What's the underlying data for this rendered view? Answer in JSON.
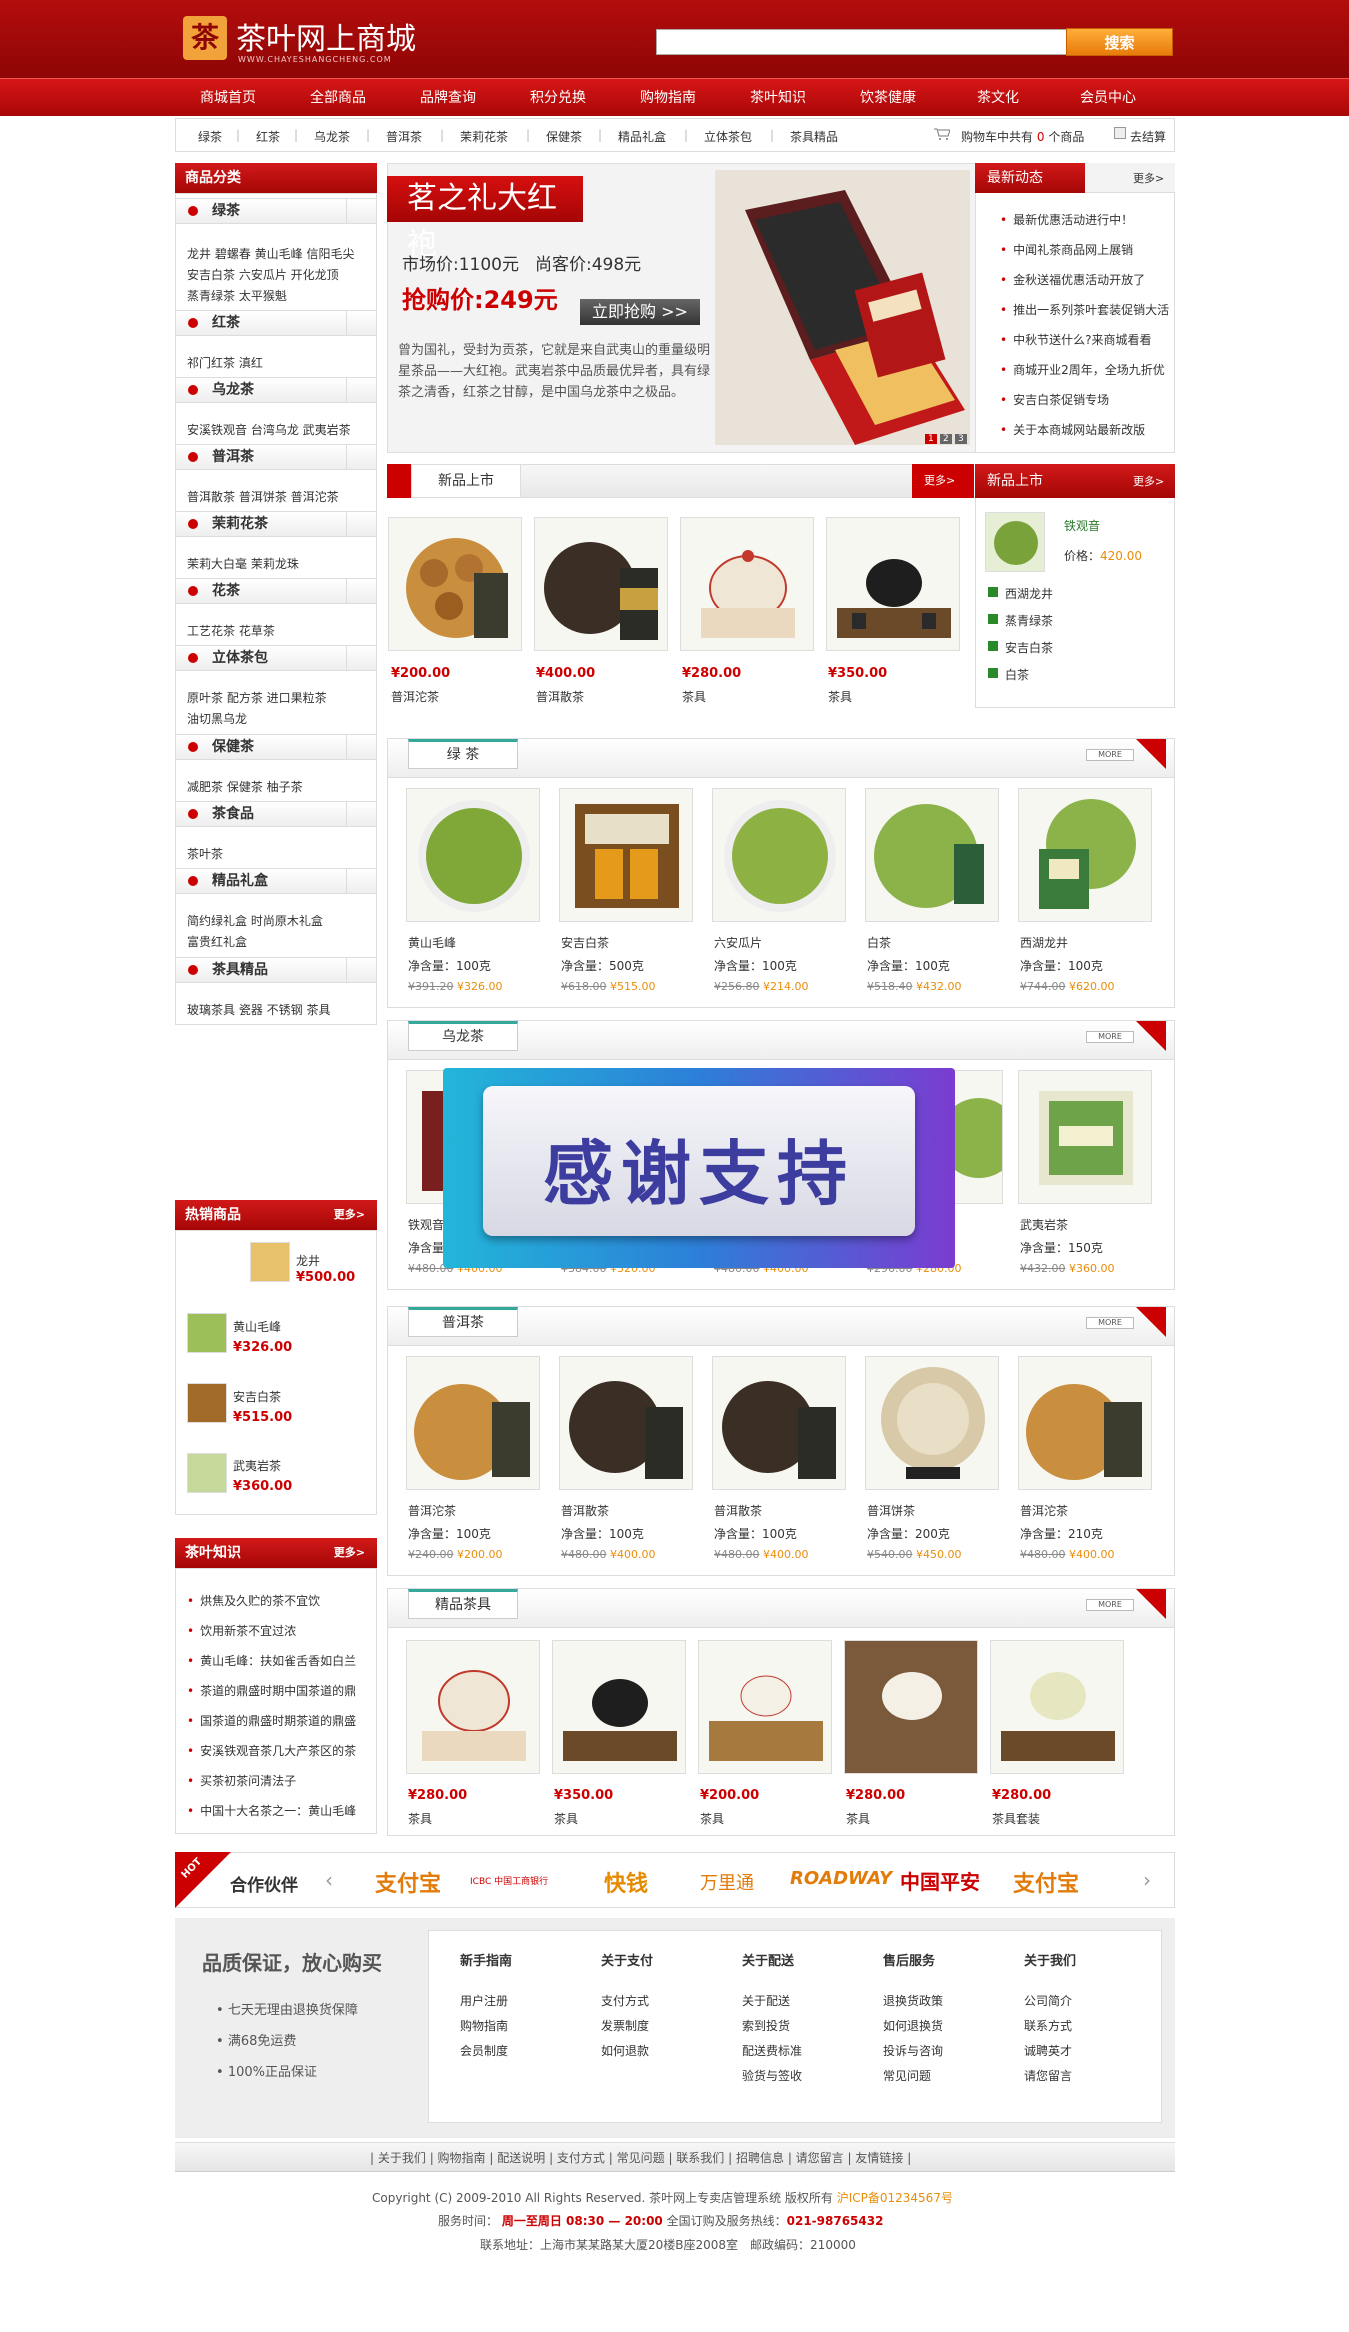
{
  "header": {
    "logo_char": "茶",
    "title": "茶叶网上商城",
    "domain": "WWW.CHAYESHANGCHENG.COM",
    "search_placeholder": "",
    "search_button": "搜索"
  },
  "nav": [
    "商城首页",
    "全部商品",
    "品牌查询",
    "积分兑换",
    "购物指南",
    "茶叶知识",
    "饮茶健康",
    "茶文化",
    "会员中心"
  ],
  "subnav": [
    "绿茶",
    "红茶",
    "乌龙茶",
    "普洱茶",
    "茉莉花茶",
    "保健茶",
    "精品礼盒",
    "立体茶包",
    "茶具精品"
  ],
  "cart": {
    "prefix": "购物车中共有",
    "count": "0",
    "suffix": "个商品",
    "checkout": "去结算"
  },
  "left": {
    "category_title": "商品分类",
    "categories": [
      {
        "name": "绿茶",
        "items": [
          "龙井 碧螺春 黄山毛峰 信阳毛尖",
          "安吉白茶 六安瓜片 开化龙顶",
          "蒸青绿茶 太平猴魁"
        ]
      },
      {
        "name": "红茶",
        "items": [
          "祁门红茶 滇红"
        ]
      },
      {
        "name": "乌龙茶",
        "items": [
          "安溪铁观音 台湾乌龙 武夷岩茶"
        ]
      },
      {
        "name": "普洱茶",
        "items": [
          "普洱散茶 普洱饼茶 普洱沱茶"
        ]
      },
      {
        "name": "茉莉花茶",
        "items": [
          "茉莉大白毫 茉莉龙珠"
        ]
      },
      {
        "name": "花茶",
        "items": [
          "工艺花茶 花草茶"
        ]
      },
      {
        "name": "立体茶包",
        "items": [
          "原叶茶 配方茶 进口果粒茶",
          "油切黑乌龙"
        ]
      },
      {
        "name": "保健茶",
        "items": [
          "减肥茶 保健茶 柚子茶"
        ]
      },
      {
        "name": "茶食品",
        "items": [
          "茶叶茶"
        ]
      },
      {
        "name": "精品礼盒",
        "items": [
          "简约绿礼盒 时尚原木礼盒",
          "富贵红礼盒"
        ]
      },
      {
        "name": "茶具精品",
        "items": [
          "玻璃茶具 瓷器 不锈钢 茶具"
        ]
      }
    ],
    "hot_title": "热销商品",
    "hot_more": "更多>",
    "hot": [
      {
        "name": "龙井",
        "price": "¥500.00"
      },
      {
        "name": "黄山毛峰",
        "price": "¥326.00"
      },
      {
        "name": "安吉白茶",
        "price": "¥515.00"
      },
      {
        "name": "武夷岩茶",
        "price": "¥360.00"
      }
    ],
    "knowledge_title": "茶叶知识",
    "knowledge_more": "更多>",
    "knowledge": [
      "烘焦及久贮的茶不宜饮",
      "饮用新茶不宜过浓",
      "黄山毛峰：扶如雀舌香如白兰",
      "茶道的鼎盛时期中国茶道的鼎",
      "国茶道的鼎盛时期茶道的鼎盛",
      "安溪铁观音茶几大产茶区的茶",
      "买茶初茶问清法子",
      "中国十大名茶之一：黄山毛峰"
    ]
  },
  "banner": {
    "title": "茗之礼大红袍",
    "market": "市场价:1100元",
    "shop": "尚客价:498元",
    "sale": "抢购价:249元",
    "button": "立即抢购 >>",
    "desc": "曾为国礼，受封为贡茶，它就是来自武夷山的重量级明星茶品——大红袍。武夷岩茶中品质最优异者，具有绿茶之清香，红茶之甘醇，是中国乌龙茶中之极品。",
    "dots": [
      "1",
      "2",
      "3"
    ]
  },
  "latest": {
    "title": "最新动态",
    "more": "更多>",
    "items": [
      "最新优惠活动进行中！",
      "中闻礼茶商品网上展销",
      "金秋送福优惠活动开放了",
      "推出一系列茶叶套装促销大活",
      "中秋节送什么?来商城看看",
      "商城开业2周年，全场九折优",
      "安吉白茶促销专场",
      "关于本商城网站最新改版"
    ]
  },
  "newarrivals": {
    "title": "新品上市",
    "more": "更多>",
    "items": [
      {
        "price": "¥200.00",
        "name": "普洱沱茶"
      },
      {
        "price": "¥400.00",
        "name": "普洱散茶"
      },
      {
        "price": "¥280.00",
        "name": "茶具"
      },
      {
        "price": "¥350.00",
        "name": "茶具"
      }
    ]
  },
  "newright": {
    "title": "新品上市",
    "more": "更多>",
    "featured": {
      "name": "铁观音",
      "price_label": "价格：",
      "price": "420.00"
    },
    "list": [
      "西湖龙井",
      "蒸青绿茶",
      "安吉白茶",
      "白茶"
    ]
  },
  "sections": [
    {
      "title": "绿 茶",
      "more": "MORE",
      "items": [
        {
          "name": "黄山毛峰",
          "net": "净含量：100克",
          "old": "¥391.20",
          "price": "¥326.00"
        },
        {
          "name": "安吉白茶",
          "net": "净含量：500克",
          "old": "¥618.00",
          "price": "¥515.00"
        },
        {
          "name": "六安瓜片",
          "net": "净含量：100克",
          "old": "¥256.80",
          "price": "¥214.00"
        },
        {
          "name": "白茶",
          "net": "净含量：100克",
          "old": "¥518.40",
          "price": "¥432.00"
        },
        {
          "name": "西湖龙井",
          "net": "净含量：100克",
          "old": "¥744.00",
          "price": "¥620.00"
        }
      ]
    },
    {
      "title": "乌龙茶",
      "more": "MORE",
      "items": [
        {
          "name": "铁观音",
          "net": "净含量",
          "old": "¥480.00",
          "price": "¥400.00"
        },
        {
          "name": "",
          "net": "净含量",
          "old": "¥384.00",
          "price": "¥320.00"
        },
        {
          "name": "",
          "net": "净含量",
          "old": "¥480.00",
          "price": "¥400.00"
        },
        {
          "name": "",
          "net": "净含量",
          "old": "¥296.00",
          "price": "¥280.00"
        },
        {
          "name": "武夷岩茶",
          "net": "净含量：150克",
          "old": "¥432.00",
          "price": "¥360.00"
        }
      ]
    },
    {
      "title": "普洱茶",
      "more": "MORE",
      "items": [
        {
          "name": "普洱沱茶",
          "net": "净含量：100克",
          "old": "¥240.00",
          "price": "¥200.00"
        },
        {
          "name": "普洱散茶",
          "net": "净含量：100克",
          "old": "¥480.00",
          "price": "¥400.00"
        },
        {
          "name": "普洱散茶",
          "net": "净含量：100克",
          "old": "¥480.00",
          "price": "¥400.00"
        },
        {
          "name": "普洱饼茶",
          "net": "净含量：200克",
          "old": "¥540.00",
          "price": "¥450.00"
        },
        {
          "name": "普洱沱茶",
          "net": "净含量：210克",
          "old": "¥480.00",
          "price": "¥400.00"
        }
      ]
    },
    {
      "title": "精品茶具",
      "more": "MORE",
      "items": [
        {
          "price": "¥280.00",
          "name": "茶具"
        },
        {
          "price": "¥350.00",
          "name": "茶具"
        },
        {
          "price": "¥200.00",
          "name": "茶具"
        },
        {
          "price": "¥280.00",
          "name": "茶具"
        },
        {
          "price": "¥280.00",
          "name": "茶具套装"
        }
      ]
    }
  ],
  "overlay": {
    "text": "感谢支持"
  },
  "partners": {
    "hot": "HOT",
    "title": "合作伙伴",
    "logos": [
      "支付宝",
      "ICBC 中国工商银行",
      "快钱",
      "万里通",
      "ROADWAY",
      "中国平安",
      "支付宝"
    ]
  },
  "guarantee": {
    "title": "品质保证，放心购买",
    "items": [
      "七天无理由退换货保障",
      "满68免运费",
      "100%正品保证"
    ]
  },
  "footcols": [
    {
      "h": "新手指南",
      "items": [
        "用户注册",
        "购物指南",
        "会员制度"
      ]
    },
    {
      "h": "关于支付",
      "items": [
        "支付方式",
        "发票制度",
        "如何退款"
      ]
    },
    {
      "h": "关于配送",
      "items": [
        "关于配送",
        "索到投货",
        "配送费标准",
        "验货与签收"
      ]
    },
    {
      "h": "售后服务",
      "items": [
        "退换货政策",
        "如何退换货",
        "投诉与咨询",
        "常见问题"
      ]
    },
    {
      "h": "关于我们",
      "items": [
        "公司简介",
        "联系方式",
        "诚聘英才",
        "请您留言"
      ]
    }
  ],
  "footlinks": [
    "关于我们",
    "购物指南",
    "配送说明",
    "支付方式",
    "常见问题",
    "联系我们",
    "招聘信息",
    "请您留言",
    "友情链接"
  ],
  "copyright": "Copyright (C) 2009-2010 All Rights Reserved. 茶叶网上专卖店管理系统 版权所有",
  "icp": "沪ICP备01234567号",
  "service": {
    "label": "服务时间：",
    "time": "周一至周日 08:30 — 20:00",
    "hotline_label": "全国订购及服务热线：",
    "hotline": "021-98765432"
  },
  "address": "联系地址：上海市某某路某大厦20楼B座2008室　邮政编码：210000"
}
